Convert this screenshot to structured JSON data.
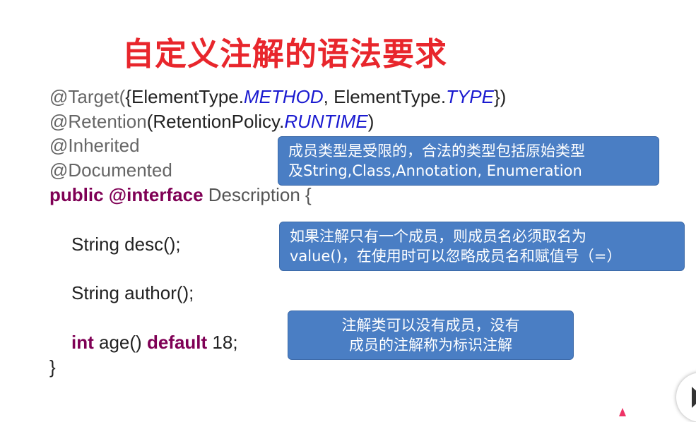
{
  "title": "自定义注解的语法要求",
  "code": {
    "l1": {
      "a": "@Target(",
      "b": "{ElementType.",
      "c": "METHOD",
      "d": ", ElementType.",
      "e": "TYPE",
      "f": "})"
    },
    "l2": {
      "a": "@Retention",
      "b": "(RetentionPolicy.",
      "c": "RUNTIME",
      "d": ")"
    },
    "l3": "@Inherited",
    "l4": "@Documented",
    "l5": {
      "kw1": "public",
      "kw2": "@interface",
      "name": "Description {"
    },
    "l6": "String desc();",
    "l7": "String author();",
    "l8": {
      "kw": "int",
      "mid": "age()",
      "kw2": "default",
      "end": "18;"
    },
    "l9": "}"
  },
  "callouts": [
    {
      "line1": "成员类型是受限的，合法的类型包括原始类型",
      "line2": "及String,Class,Annotation, Enumeration"
    },
    {
      "line1": "如果注解只有一个成员，则成员名必须取名为",
      "line2": "value()，在使用时可以忽略成员名和赋值号（=）"
    },
    {
      "line1": "注解类可以没有成员，没有",
      "line2": "成员的注解称为标识注解"
    }
  ]
}
